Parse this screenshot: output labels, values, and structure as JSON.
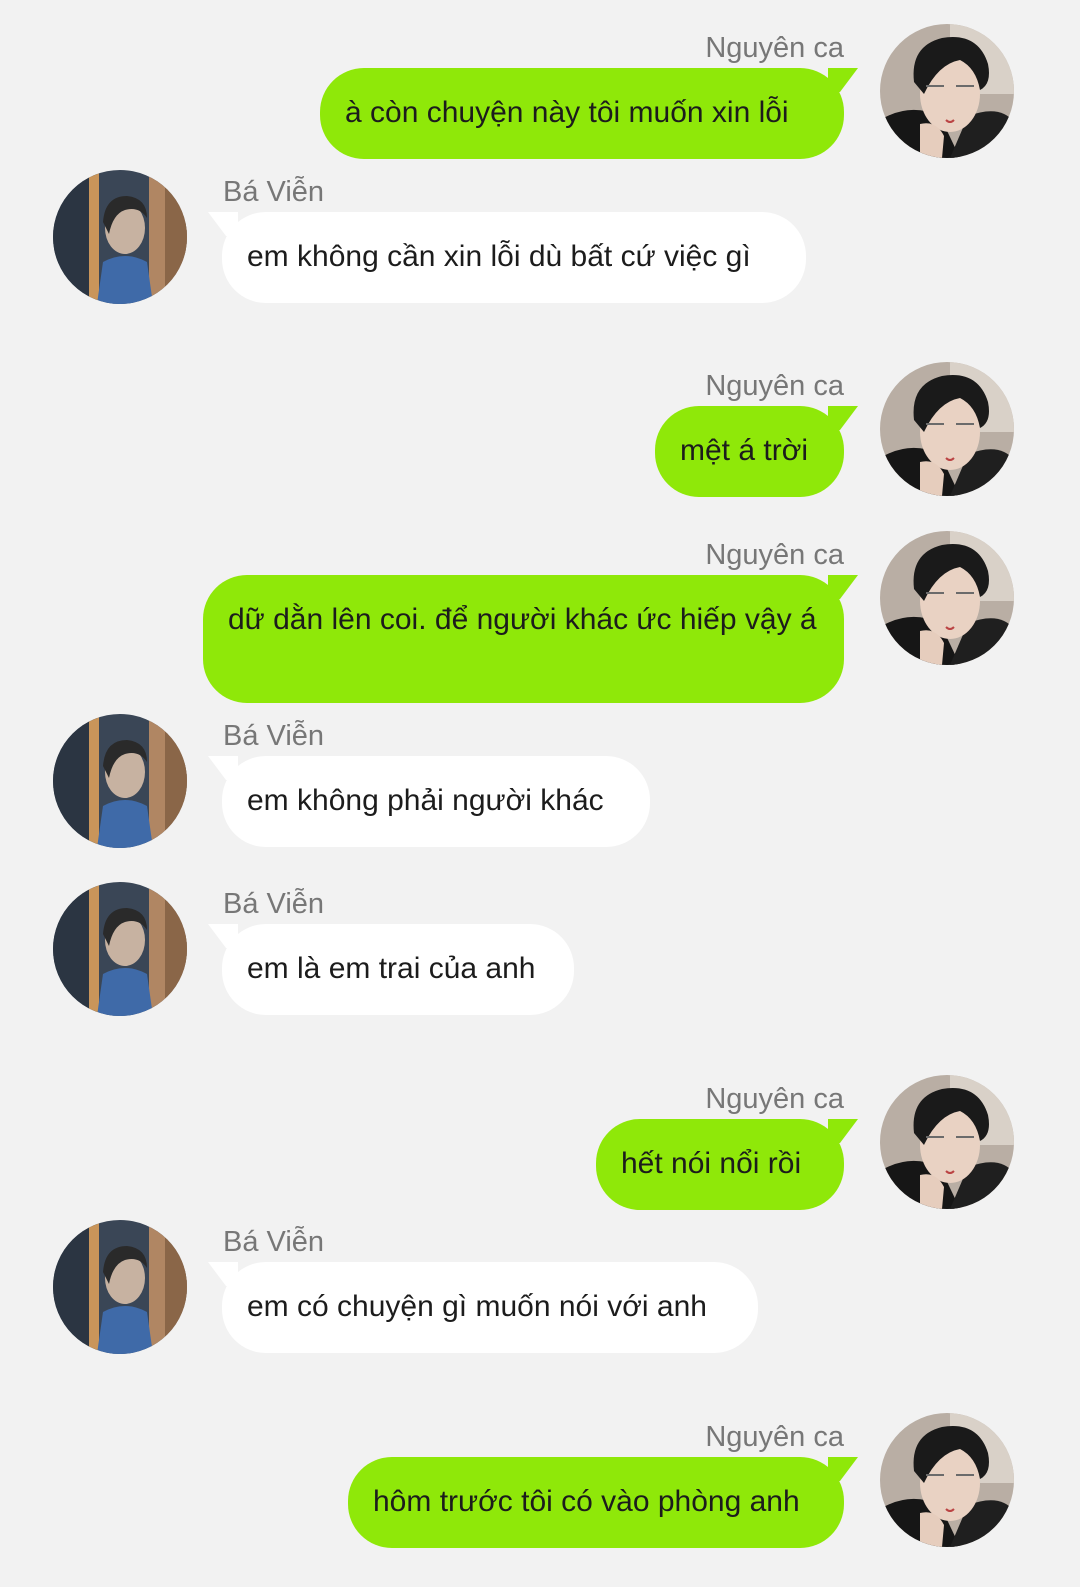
{
  "conversation": {
    "participants": {
      "me": {
        "name": "Nguyên ca",
        "avatar_icon": "avatar-dark-hair-man-icon"
      },
      "them": {
        "name": "Bá Viễn",
        "avatar_icon": "avatar-window-profile-icon"
      }
    },
    "colors": {
      "background": "#f2f2f2",
      "my_bubble": "#8fe809",
      "their_bubble": "#ffffff",
      "sender_text": "#777777"
    },
    "messages": [
      {
        "from": "me",
        "sender": "Nguyên ca",
        "text": "à còn chuyện này tôi muốn xin lỗi"
      },
      {
        "from": "them",
        "sender": "Bá Viễn",
        "text": "em không cần xin lỗi dù bất cứ việc gì"
      },
      {
        "from": "me",
        "sender": "Nguyên ca",
        "text": "mệt á trời"
      },
      {
        "from": "me",
        "sender": "Nguyên ca",
        "text": "dữ dằn lên coi. để người khác ức hiếp vậy á"
      },
      {
        "from": "them",
        "sender": "Bá Viễn",
        "text": "em không phải người khác"
      },
      {
        "from": "them",
        "sender": "Bá Viễn",
        "text": "em là em trai của anh"
      },
      {
        "from": "me",
        "sender": "Nguyên ca",
        "text": "hết nói nổi rồi"
      },
      {
        "from": "them",
        "sender": "Bá Viễn",
        "text": "em có chuyện gì muốn nói với anh"
      },
      {
        "from": "me",
        "sender": "Nguyên ca",
        "text": "hôm trước tôi có vào phòng anh"
      }
    ]
  }
}
